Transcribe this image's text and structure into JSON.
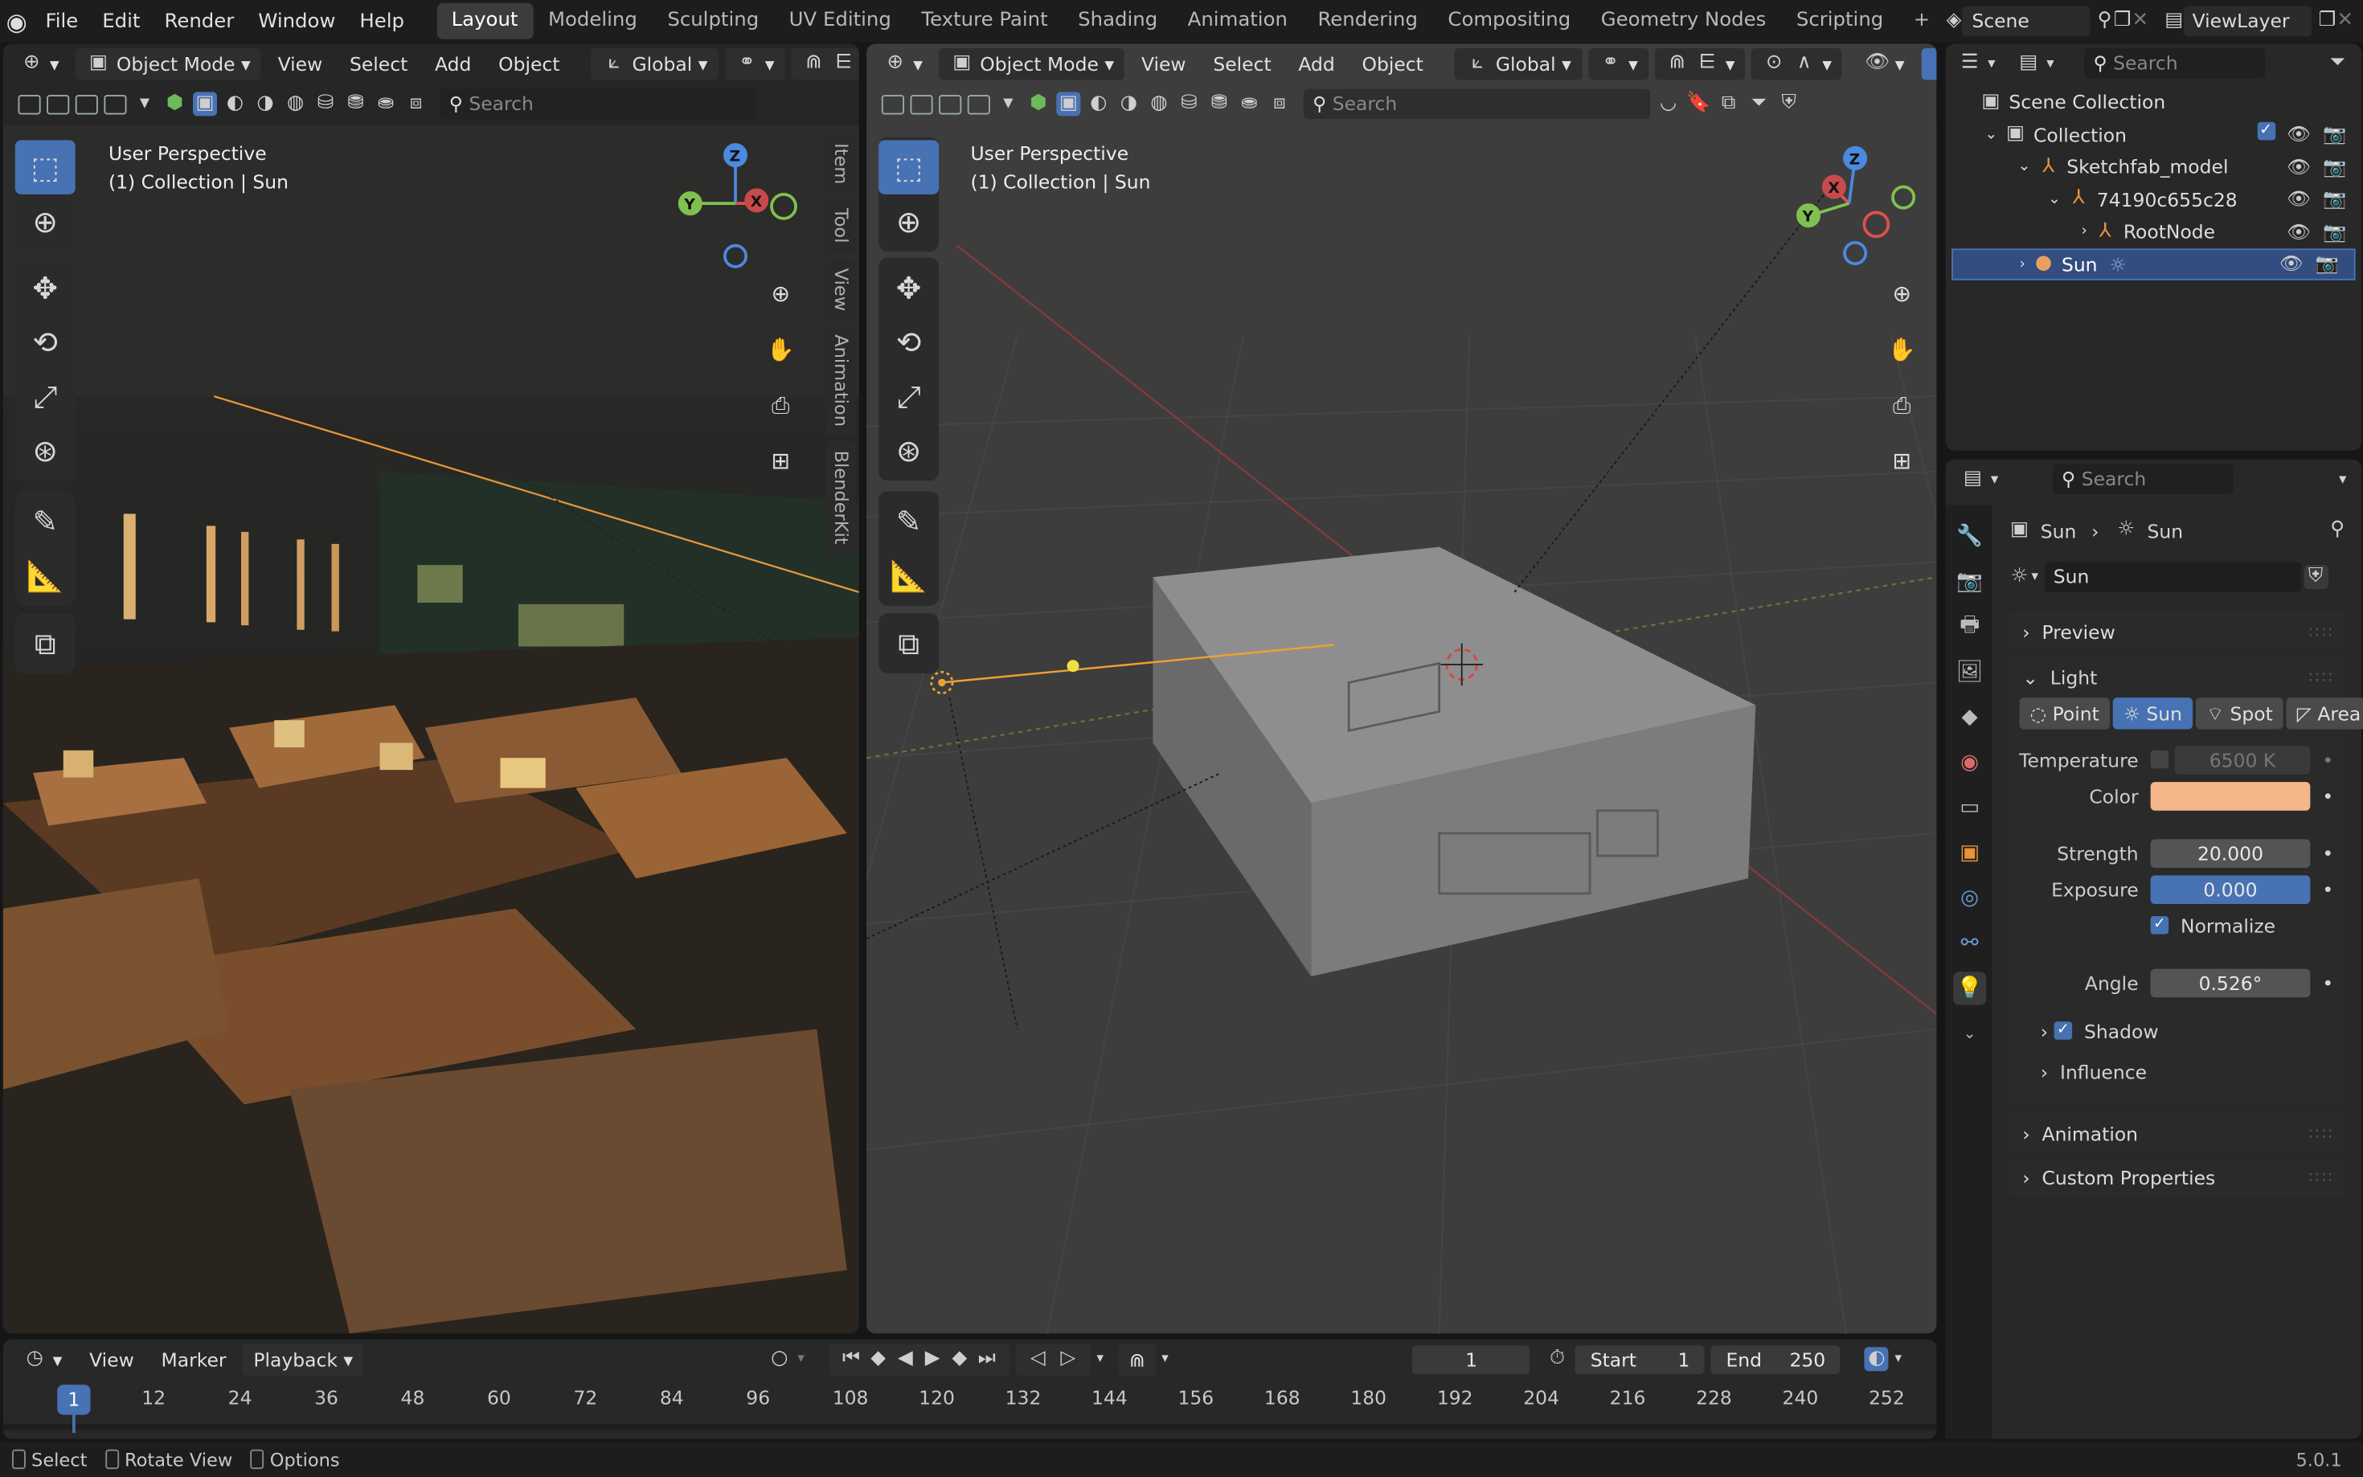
{
  "menu": [
    "File",
    "Edit",
    "Render",
    "Window",
    "Help"
  ],
  "workspaces": [
    "Layout",
    "Modeling",
    "Sculpting",
    "UV Editing",
    "Texture Paint",
    "Shading",
    "Animation",
    "Rendering",
    "Compositing",
    "Geometry Nodes",
    "Scripting"
  ],
  "scene_name": "Scene",
  "view_layer": "ViewLayer",
  "vp_header": {
    "mode": "Object Mode",
    "view": "View",
    "select": "Select",
    "add": "Add",
    "object": "Object",
    "orientation": "Global",
    "search_placeholder": "Search"
  },
  "vp_left": {
    "label1": "User Perspective",
    "label2": "(1) Collection | Sun",
    "tabs": [
      "Item",
      "Tool",
      "View",
      "Animation",
      "BlenderKit"
    ]
  },
  "vp_right": {
    "label1": "User Perspective",
    "label2": "(1) Collection | Sun"
  },
  "gizmo": {
    "x": "X",
    "y": "Y",
    "z": "Z"
  },
  "outliner": {
    "search_placeholder": "Search",
    "rows": [
      "Scene Collection",
      "Collection",
      "Sketchfab_model",
      "74190c655c28",
      "RootNode",
      "Sun"
    ]
  },
  "props": {
    "search_placeholder": "Search",
    "breadcrumb_obj": "Sun",
    "breadcrumb_data": "Sun",
    "datablock": "Sun",
    "panels": {
      "preview": "Preview",
      "light": "Light",
      "animation": "Animation",
      "custom": "Custom Properties"
    },
    "light_types": [
      "Point",
      "Sun",
      "Spot",
      "Area"
    ],
    "temperature_label": "Temperature",
    "temperature_value": "6500 K",
    "color_label": "Color",
    "color_value": "#f5b68a",
    "strength_label": "Strength",
    "strength_value": "20.000",
    "exposure_label": "Exposure",
    "exposure_value": "0.000",
    "normalize_label": "Normalize",
    "angle_label": "Angle",
    "angle_value": "0.526°",
    "shadow_label": "Shadow",
    "influence_label": "Influence"
  },
  "timeline": {
    "view": "View",
    "marker": "Marker",
    "playback": "Playback",
    "current_frame": "1",
    "start_label": "Start",
    "start_value": "1",
    "end_label": "End",
    "end_value": "250",
    "ticks": [
      "12",
      "24",
      "36",
      "48",
      "60",
      "72",
      "84",
      "96",
      "108",
      "120",
      "132",
      "144",
      "156",
      "168",
      "180",
      "192",
      "204",
      "216",
      "228",
      "240",
      "252"
    ],
    "playhead": "1"
  },
  "status": {
    "select": "Select",
    "rotate": "Rotate View",
    "options": "Options",
    "version": "5.0.1"
  }
}
